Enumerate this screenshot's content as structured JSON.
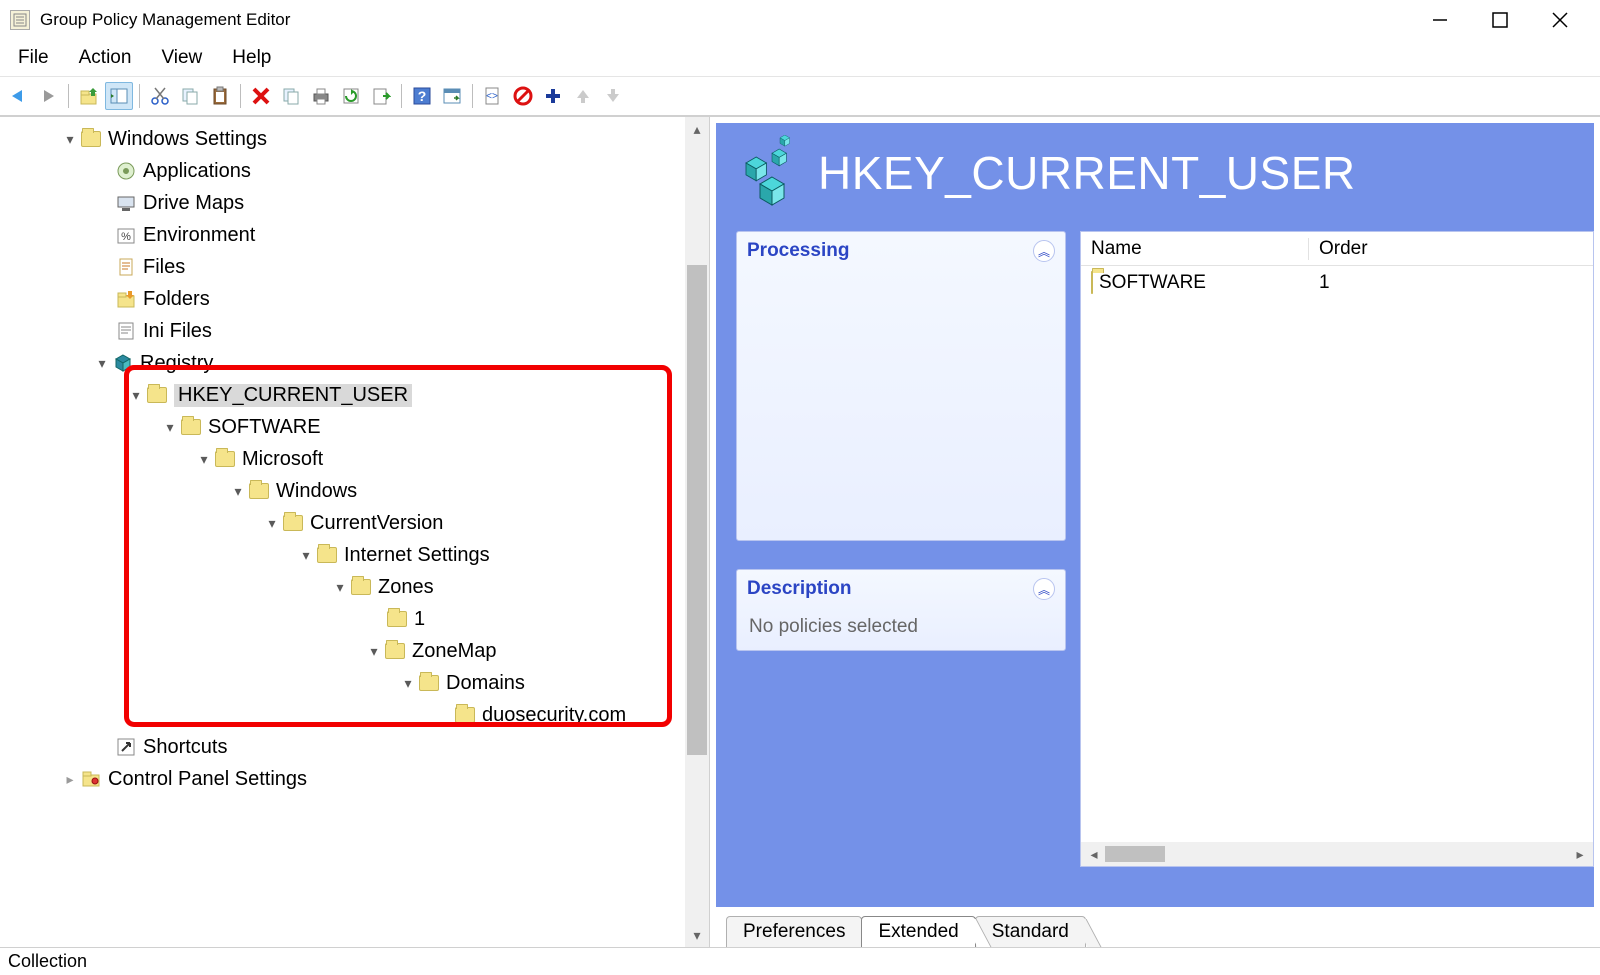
{
  "window": {
    "title": "Group Policy Management Editor"
  },
  "menus": {
    "file": "File",
    "action": "Action",
    "view": "View",
    "help": "Help"
  },
  "toolbar": {
    "back": "back",
    "forward": "forward",
    "up_folder": "up-folder",
    "show_hide": "show-hide",
    "cut": "cut",
    "copy": "copy",
    "paste": "paste",
    "delete": "delete",
    "copy2": "copy-to",
    "print": "print",
    "refresh": "refresh",
    "export": "export",
    "help": "help",
    "props": "properties",
    "pref_item": "preference-item",
    "stop": "stop",
    "add": "add",
    "move_up": "move-up",
    "move_dn": "move-down"
  },
  "tree": {
    "windows_settings": "Windows Settings",
    "applications": "Applications",
    "drive_maps": "Drive Maps",
    "environment": "Environment",
    "files": "Files",
    "folders": "Folders",
    "ini_files": "Ini Files",
    "registry": "Registry",
    "hkcu": "HKEY_CURRENT_USER",
    "software": "SOFTWARE",
    "microsoft": "Microsoft",
    "windows": "Windows",
    "currentversion": "CurrentVersion",
    "internet_settings": "Internet Settings",
    "zones": "Zones",
    "one": "1",
    "zonemap": "ZoneMap",
    "domains": "Domains",
    "duosecurity": "duosecurity.com",
    "shortcuts": "Shortcuts",
    "control_panel_settings": "Control Panel Settings"
  },
  "detail": {
    "title": "HKEY_CURRENT_USER",
    "processing_heading": "Processing",
    "description_heading": "Description",
    "description_body": "No policies selected",
    "columns": {
      "name": "Name",
      "order": "Order"
    },
    "rows": [
      {
        "name": "SOFTWARE",
        "order": "1"
      }
    ]
  },
  "tabs": {
    "preferences": "Preferences",
    "extended": "Extended",
    "standard": "Standard"
  },
  "statusbar": {
    "text": "Collection"
  }
}
